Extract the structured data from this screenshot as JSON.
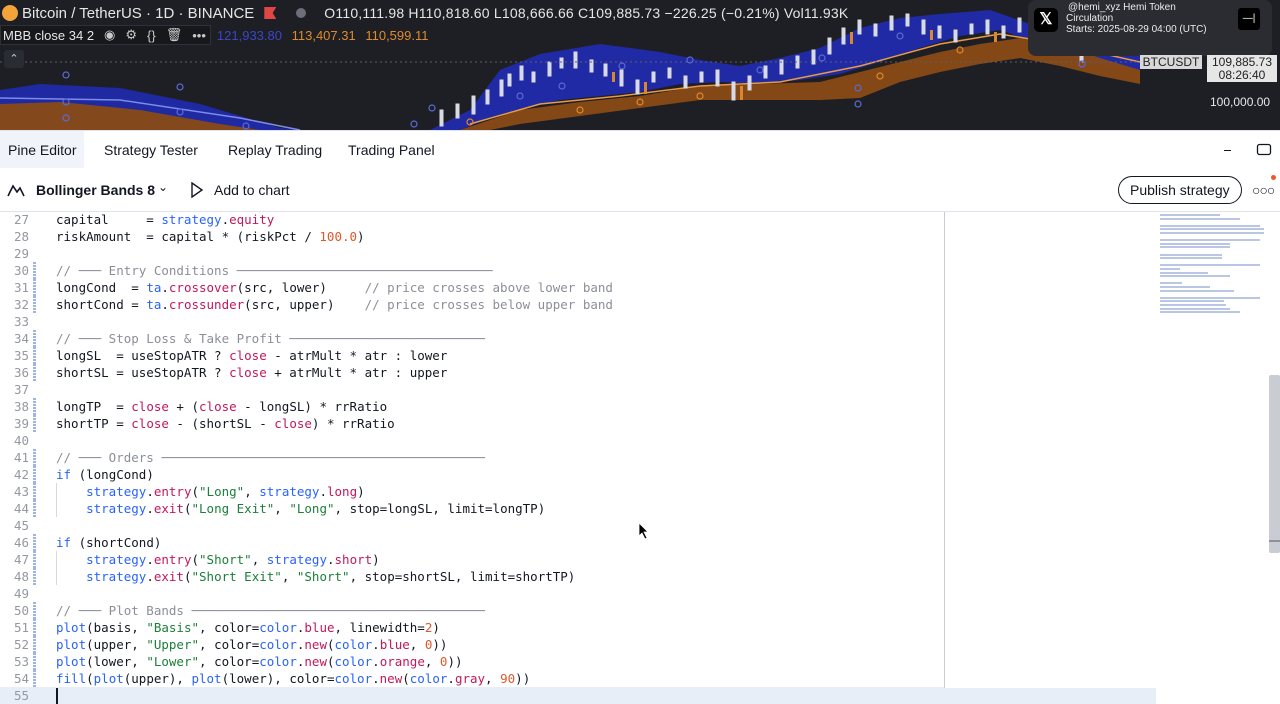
{
  "chart_header": {
    "symbol": "Bitcoin / TetherUS · 1D · BINANCE",
    "ohlc": "O110,111.98 H110,818.60 L108,666.66 C109,885.73 −226.25 (−0.21%) Vol11.93K"
  },
  "indicator": {
    "label": "MBB close 34 2",
    "value1": "121,933.80",
    "value2": "113,407.31",
    "value3": "110,599.11"
  },
  "notification": {
    "title": "@hemi_xyz Hemi Token",
    "line2": "Circulation",
    "line3": "Starts: 2025-08-29 04:00 (UTC)"
  },
  "price_scale": {
    "symbol_tag": "BTCUSDT",
    "last_price": "109,885.73",
    "countdown": "08:26:40",
    "level": "100,000.00"
  },
  "panel_tabs": [
    "Pine Editor",
    "Strategy Tester",
    "Replay Trading",
    "Trading Panel"
  ],
  "toolbar": {
    "script_name": "Bollinger Bands 8",
    "add_to_chart": "Add to chart",
    "publish": "Publish strategy"
  },
  "colors": {
    "upper_band": "#1f2bb0",
    "lower_band": "#c96a1f",
    "chart_bg": "#1e1f24",
    "accent": "#2962ff"
  },
  "code_lines": [
    {
      "n": "27",
      "text": "capital     = strategy.equity"
    },
    {
      "n": "28",
      "text": "riskAmount  = capital * (riskPct / 100.0)"
    },
    {
      "n": "29",
      "text": ""
    },
    {
      "n": "30",
      "text": "// ─── Entry Conditions ──────────────────────────────────"
    },
    {
      "n": "31",
      "text": "longCond  = ta.crossover(src, lower)     // price crosses above lower band"
    },
    {
      "n": "32",
      "text": "shortCond = ta.crossunder(src, upper)    // price crosses below upper band"
    },
    {
      "n": "33",
      "text": ""
    },
    {
      "n": "34",
      "text": "// ─── Stop Loss & Take Profit ──────────────────────────"
    },
    {
      "n": "35",
      "text": "longSL  = useStopATR ? close - atrMult * atr : lower"
    },
    {
      "n": "36",
      "text": "shortSL = useStopATR ? close + atrMult * atr : upper"
    },
    {
      "n": "37",
      "text": ""
    },
    {
      "n": "38",
      "text": "longTP  = close + (close - longSL) * rrRatio"
    },
    {
      "n": "39",
      "text": "shortTP = close - (shortSL - close) * rrRatio"
    },
    {
      "n": "40",
      "text": ""
    },
    {
      "n": "41",
      "text": "// ─── Orders ───────────────────────────────────────────"
    },
    {
      "n": "42",
      "text": "if (longCond)"
    },
    {
      "n": "43",
      "text": "    strategy.entry(\"Long\", strategy.long)"
    },
    {
      "n": "44",
      "text": "    strategy.exit(\"Long Exit\", \"Long\", stop=longSL, limit=longTP)"
    },
    {
      "n": "45",
      "text": ""
    },
    {
      "n": "46",
      "text": "if (shortCond)"
    },
    {
      "n": "47",
      "text": "    strategy.entry(\"Short\", strategy.short)"
    },
    {
      "n": "48",
      "text": "    strategy.exit(\"Short Exit\", \"Short\", stop=shortSL, limit=shortTP)"
    },
    {
      "n": "49",
      "text": ""
    },
    {
      "n": "50",
      "text": "// ─── Plot Bands ───────────────────────────────────────"
    },
    {
      "n": "51",
      "text": "plot(basis, \"Basis\", color=color.blue, linewidth=2)"
    },
    {
      "n": "52",
      "text": "plot(upper, \"Upper\", color=color.new(color.blue, 0))"
    },
    {
      "n": "53",
      "text": "plot(lower, \"Lower\", color=color.new(color.orange, 0))"
    },
    {
      "n": "54",
      "text": "fill(plot(upper), plot(lower), color=color.new(color.gray, 90))"
    },
    {
      "n": "55",
      "text": ""
    }
  ]
}
